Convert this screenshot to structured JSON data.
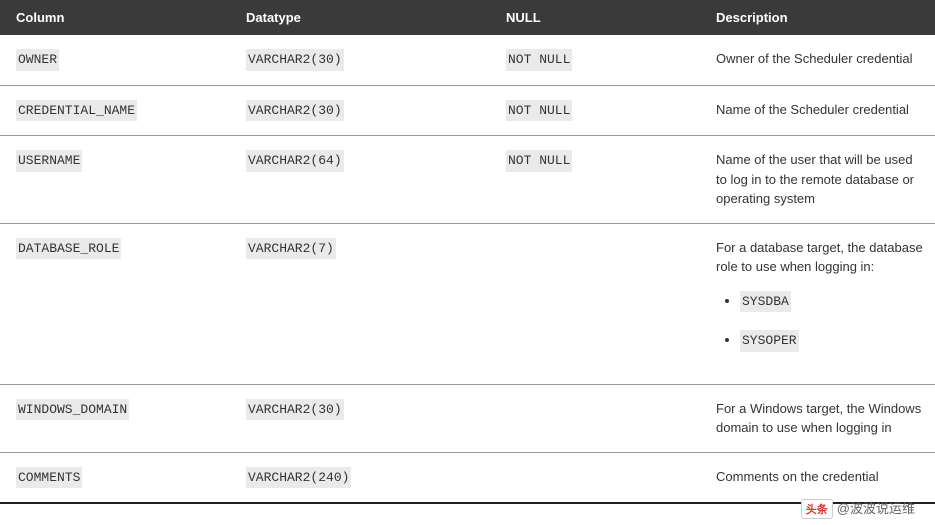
{
  "headers": {
    "column": "Column",
    "datatype": "Datatype",
    "null_": "NULL",
    "description": "Description"
  },
  "rows": [
    {
      "column": "OWNER",
      "datatype": "VARCHAR2(30)",
      "null_": "NOT NULL",
      "description": "Owner of the Scheduler credential",
      "list": null
    },
    {
      "column": "CREDENTIAL_NAME",
      "datatype": "VARCHAR2(30)",
      "null_": "NOT NULL",
      "description": "Name of the Scheduler credential",
      "list": null
    },
    {
      "column": "USERNAME",
      "datatype": "VARCHAR2(64)",
      "null_": "NOT NULL",
      "description": "Name of the user that will be used to log in to the remote database or operating system",
      "list": null
    },
    {
      "column": "DATABASE_ROLE",
      "datatype": "VARCHAR2(7)",
      "null_": "",
      "description": "For a database target, the database role to use when logging in:",
      "list": [
        "SYSDBA",
        "SYSOPER"
      ]
    },
    {
      "column": "WINDOWS_DOMAIN",
      "datatype": "VARCHAR2(30)",
      "null_": "",
      "description": "For a Windows target, the Windows domain to use when logging in",
      "list": null
    },
    {
      "column": "COMMENTS",
      "datatype": "VARCHAR2(240)",
      "null_": "",
      "description": "Comments on the credential",
      "list": null
    }
  ],
  "watermark": {
    "badge": "头条",
    "text": "@波波说运维"
  }
}
